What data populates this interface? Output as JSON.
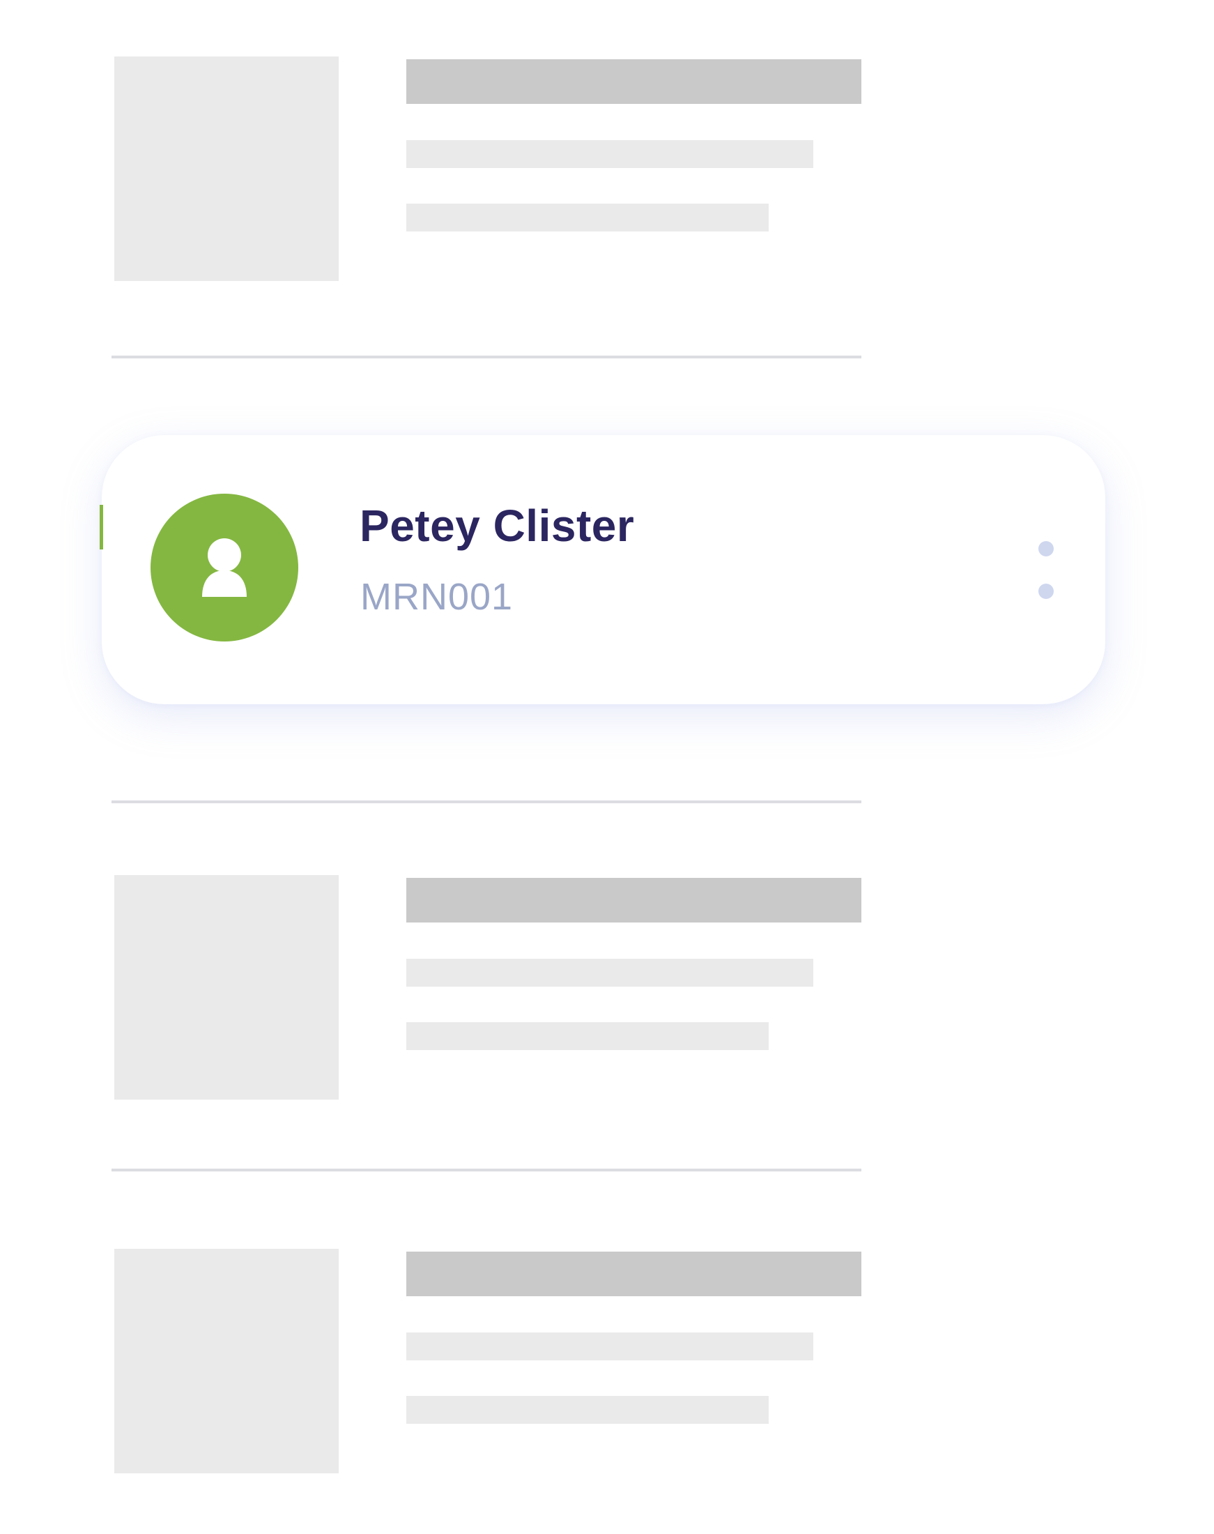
{
  "patient_card": {
    "name": "Petey Clister",
    "mrn": "MRN001",
    "avatar_icon": "user-icon",
    "menu_icon": "more-vertical-icon"
  },
  "colors": {
    "accent": "#84b741",
    "name_text": "#2b2660",
    "mrn_text": "#9aa6c7",
    "skeleton_light": "#eaeaea",
    "skeleton_dark": "#c9c9c9",
    "divider": "#dcdce2",
    "menu_dots": "#cfd7ef"
  }
}
